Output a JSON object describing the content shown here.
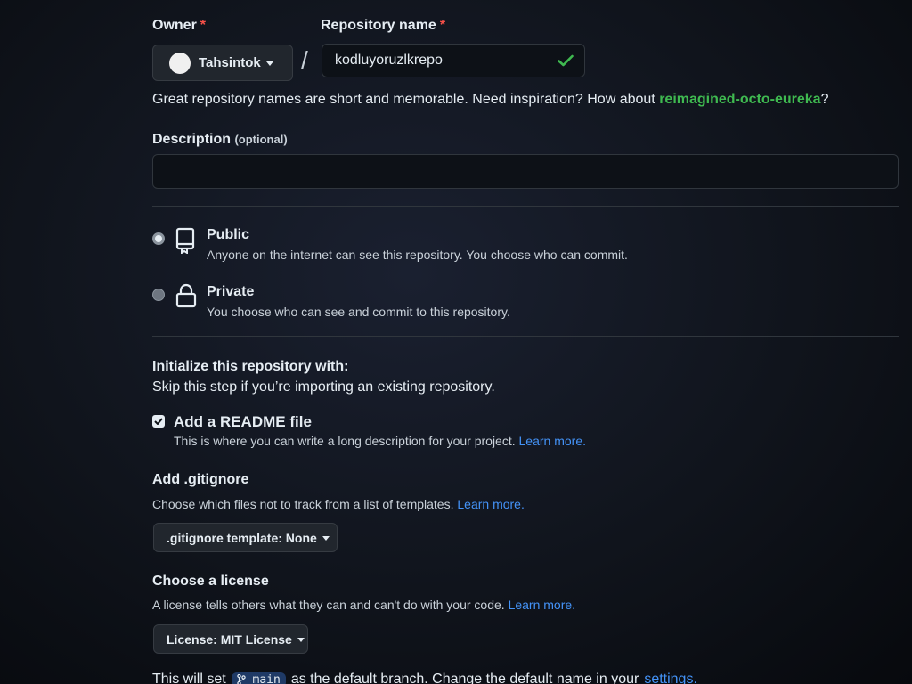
{
  "owner": {
    "label": "Owner",
    "required_mark": "*",
    "value": "Tahsintok"
  },
  "separator": "/",
  "repo_name": {
    "label": "Repository name",
    "required_mark": "*",
    "value": "kodluyoruzlkrepo"
  },
  "suggestion": {
    "text": "Great repository names are short and memorable. Need inspiration? How about",
    "name": "reimagined-octo-eureka",
    "suffix": "?"
  },
  "description": {
    "label": "Description",
    "optional": "(optional)",
    "value": ""
  },
  "visibility": {
    "public": {
      "title": "Public",
      "desc": "Anyone on the internet can see this repository. You choose who can commit.",
      "selected": true
    },
    "private": {
      "title": "Private",
      "desc": "You choose who can see and commit to this repository.",
      "selected": false
    }
  },
  "initialize": {
    "title": "Initialize this repository with:",
    "subtitle": "Skip this step if you’re importing an existing repository.",
    "readme": {
      "label": "Add a README file",
      "desc": "This is where you can write a long description for your project.",
      "link": "Learn more.",
      "checked": true
    }
  },
  "gitignore": {
    "title": "Add .gitignore",
    "desc": "Choose which files not to track from a list of templates.",
    "link": "Learn more.",
    "button": ".gitignore template: None"
  },
  "license": {
    "title": "Choose a license",
    "desc": "A license tells others what they can and can't do with your code.",
    "link": "Learn more.",
    "button": "License: MIT License"
  },
  "branch_note": {
    "prefix": "This will set",
    "branch": "main",
    "middle": "as the default branch. Change the default name in your",
    "link": "settings."
  },
  "colors": {
    "accent_link": "#4493f8",
    "success": "#3fb950",
    "danger": "#f85149"
  }
}
